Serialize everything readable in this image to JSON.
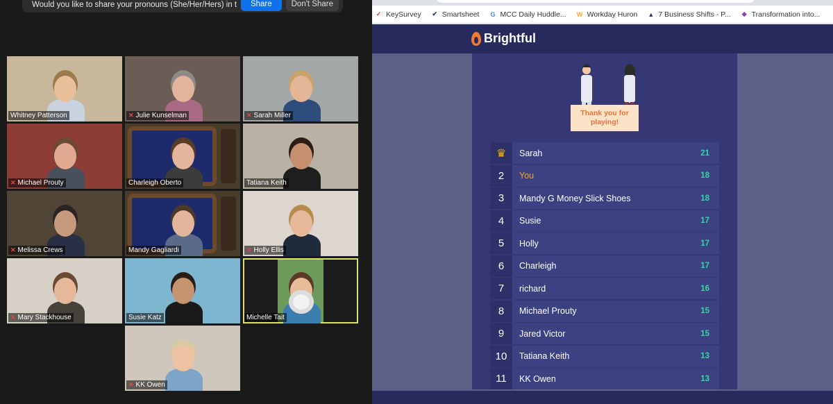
{
  "zoom": {
    "notification": {
      "text": "Would you like to share your pronouns (She/Her/Hers) in this meeting?",
      "share_label": "Share",
      "dont_share_label": "Don't Share"
    },
    "participants": [
      {
        "name": "Whitney Patterson",
        "muted": false
      },
      {
        "name": "Julie Kunselman",
        "muted": true
      },
      {
        "name": "Sarah Miller",
        "muted": true
      },
      {
        "name": "Michael Prouty",
        "muted": true
      },
      {
        "name": "Charleigh Oberto",
        "muted": false
      },
      {
        "name": "Tatiana Keith",
        "muted": false
      },
      {
        "name": "Melissa Crews",
        "muted": true
      },
      {
        "name": "Mandy Gagliardi",
        "muted": false
      },
      {
        "name": "Holly Ellis",
        "muted": true
      },
      {
        "name": "Mary Stackhouse",
        "muted": true
      },
      {
        "name": "Susie Katz",
        "muted": false
      },
      {
        "name": "Michelle Tait",
        "muted": false
      },
      {
        "name": "KK Owen",
        "muted": true
      }
    ]
  },
  "browser": {
    "bookmarks": [
      {
        "label": "KeySurvey",
        "icon": "keysurvey-icon",
        "glyph": "✓",
        "color": "#c0392b"
      },
      {
        "label": "Smartsheet",
        "icon": "smartsheet-icon",
        "glyph": "✔",
        "color": "#1f3c6b"
      },
      {
        "label": "MCC Daily Huddle...",
        "icon": "google-icon",
        "glyph": "G",
        "color": "#4285f4"
      },
      {
        "label": "Workday Huron",
        "icon": "workday-icon",
        "glyph": "W",
        "color": "#f5a623"
      },
      {
        "label": "7 Business Shifts - P...",
        "icon": "chart-icon",
        "glyph": "▲",
        "color": "#2b3a67"
      },
      {
        "label": "Transformation into...",
        "icon": "diamond-icon",
        "glyph": "◆",
        "color": "#8e44ad"
      }
    ],
    "brand": "Brightful",
    "sign_text": "Thank you for playing!",
    "leaderboard": [
      {
        "rank": "",
        "name": "Sarah",
        "score": "21",
        "trophy": true,
        "you": false
      },
      {
        "rank": "2",
        "name": "You",
        "score": "18",
        "trophy": false,
        "you": true
      },
      {
        "rank": "3",
        "name": "Mandy G Money Slick Shoes",
        "score": "18",
        "trophy": false,
        "you": false
      },
      {
        "rank": "4",
        "name": "Susie",
        "score": "17",
        "trophy": false,
        "you": false
      },
      {
        "rank": "5",
        "name": "Holly",
        "score": "17",
        "trophy": false,
        "you": false
      },
      {
        "rank": "6",
        "name": "Charleigh",
        "score": "17",
        "trophy": false,
        "you": false
      },
      {
        "rank": "7",
        "name": "richard",
        "score": "16",
        "trophy": false,
        "you": false
      },
      {
        "rank": "8",
        "name": "Michael Prouty",
        "score": "15",
        "trophy": false,
        "you": false
      },
      {
        "rank": "9",
        "name": "Jared Victor",
        "score": "15",
        "trophy": false,
        "you": false
      },
      {
        "rank": "10",
        "name": "Tatiana Keith",
        "score": "13",
        "trophy": false,
        "you": false
      },
      {
        "rank": "11",
        "name": "KK Owen",
        "score": "13",
        "trophy": false,
        "you": false
      }
    ]
  }
}
